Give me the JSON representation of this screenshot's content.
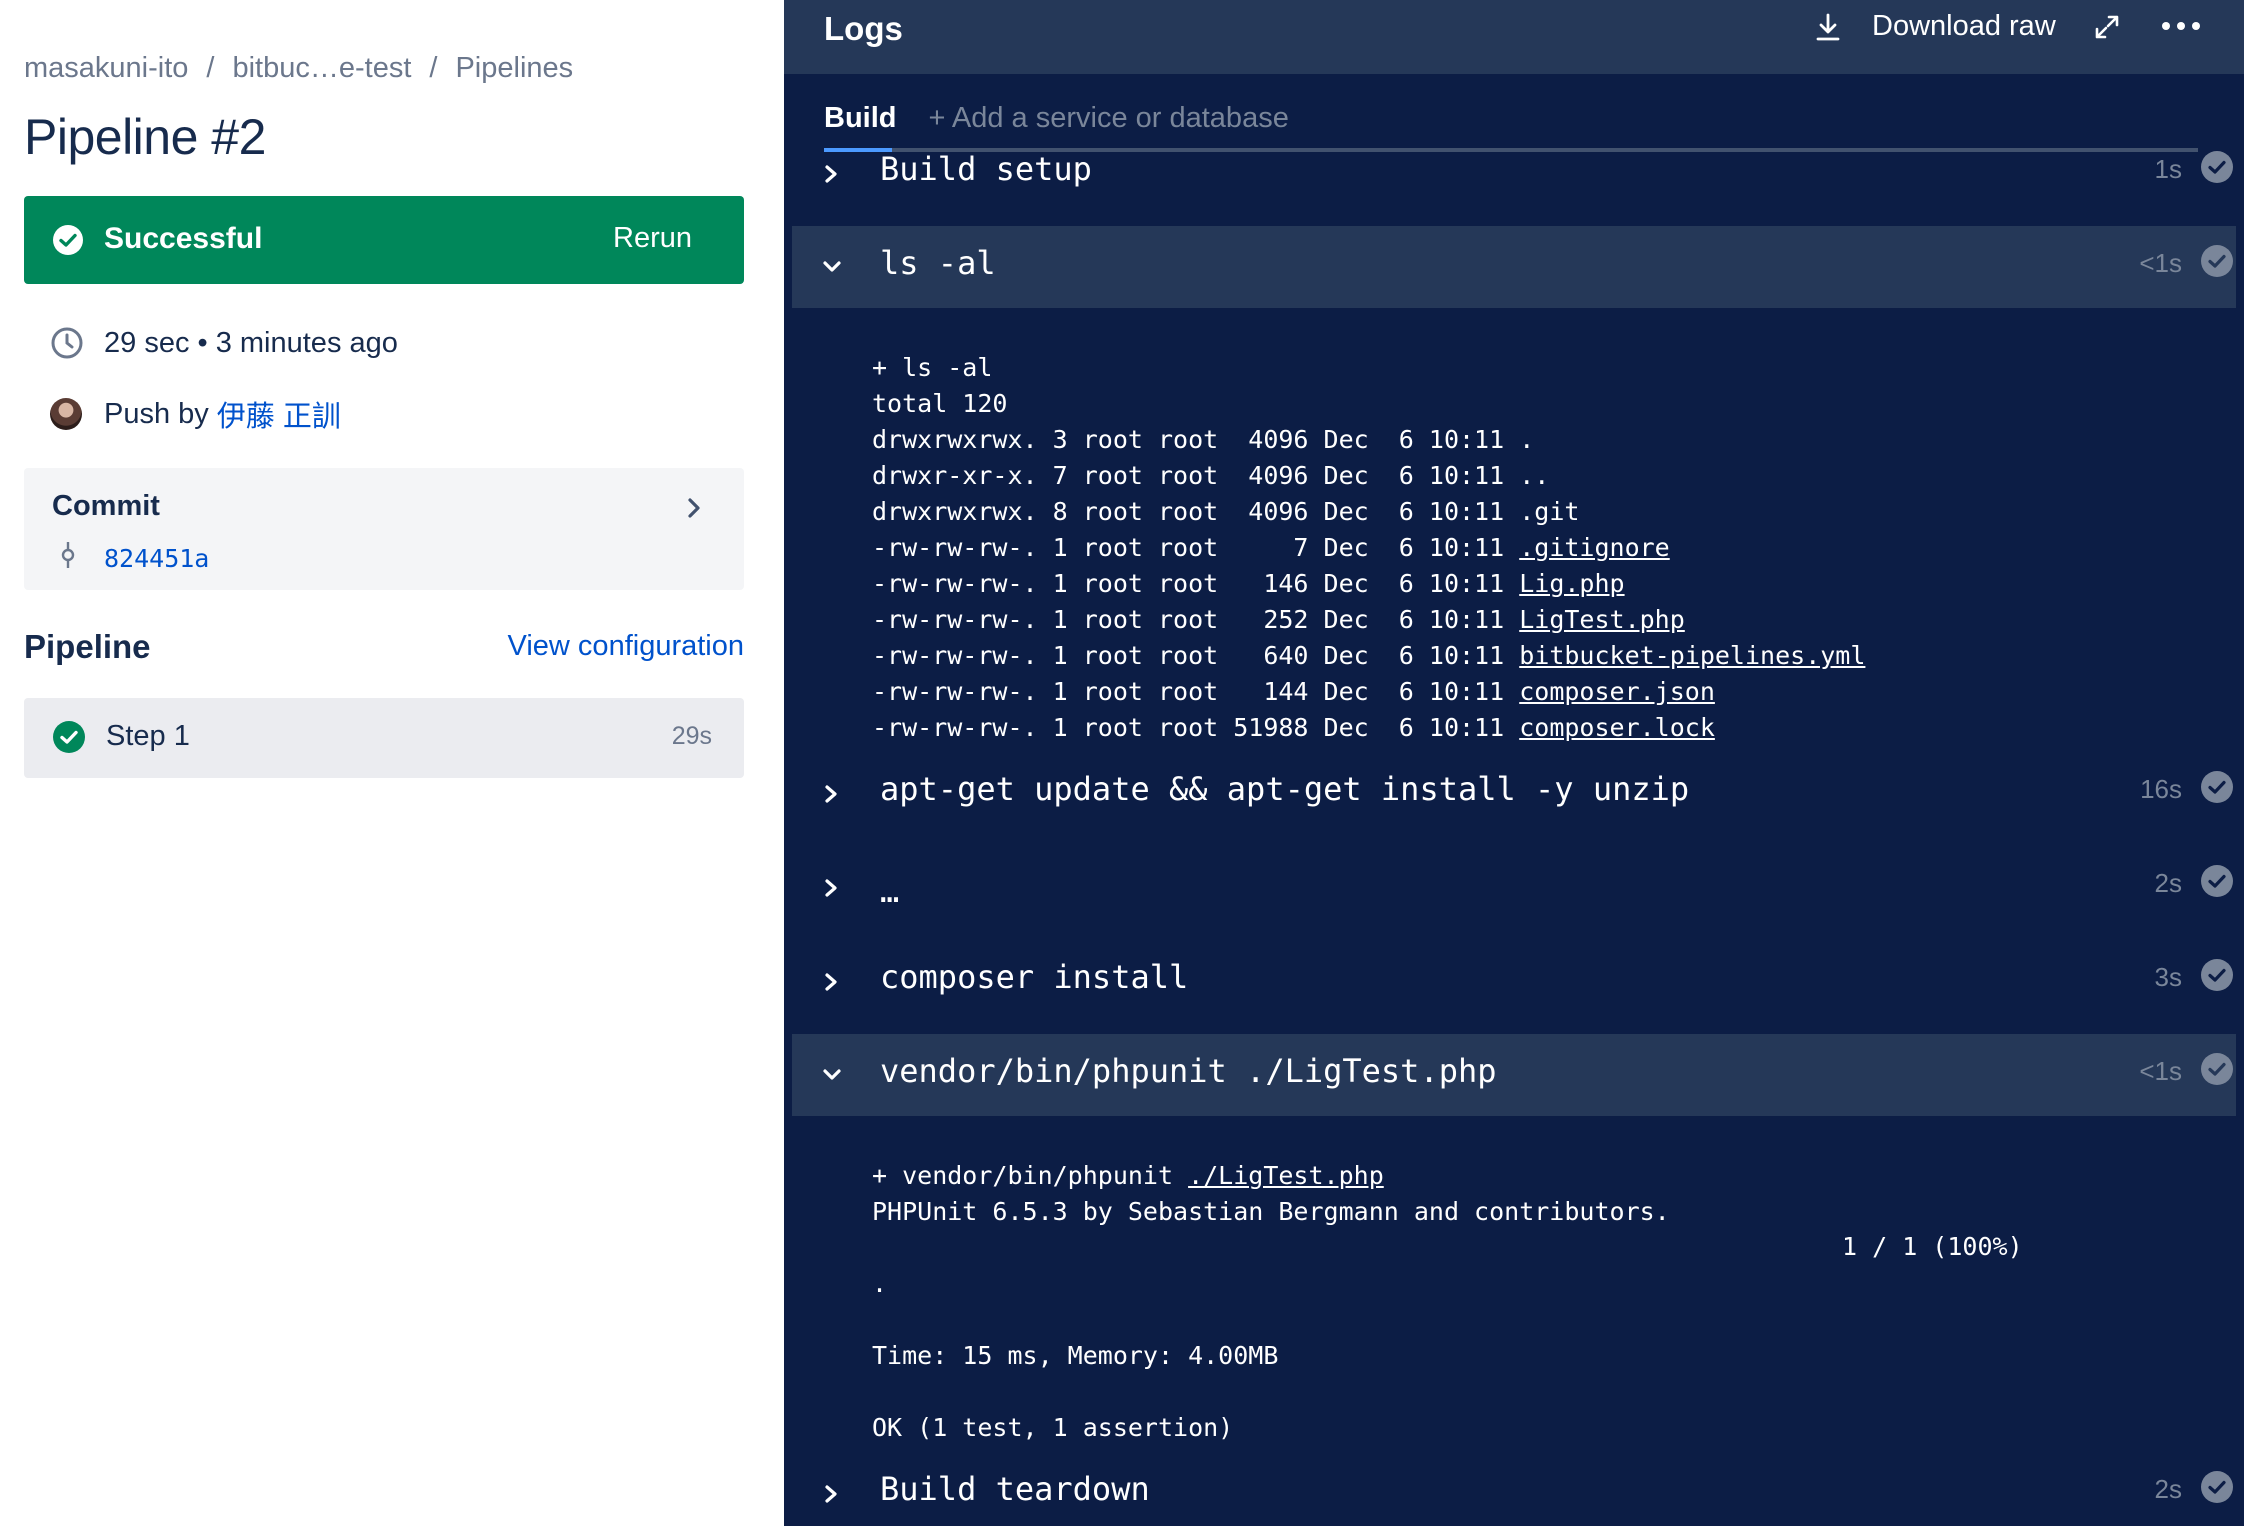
{
  "breadcrumb": {
    "items": [
      "masakuni-ito",
      "bitbuc…e-test",
      "Pipelines"
    ],
    "separator": "/"
  },
  "page_title": "Pipeline #2",
  "status": {
    "label": "Successful",
    "rerun_label": "Rerun",
    "color": "#00875a"
  },
  "meta": {
    "duration_text": "29 sec • 3 minutes ago",
    "push_prefix": "Push by",
    "author": "伊藤 正訓"
  },
  "commit": {
    "title": "Commit",
    "hash": "824451a"
  },
  "pipeline": {
    "title": "Pipeline",
    "view_config_label": "View configuration",
    "steps": [
      {
        "label": "Step 1",
        "duration": "29s"
      }
    ]
  },
  "logs": {
    "title": "Logs",
    "download_label": "Download raw",
    "tabs": {
      "build": "Build",
      "add": "+ Add a service or database"
    },
    "sections": [
      {
        "command": "Build setup",
        "duration": "1s",
        "expanded": false
      },
      {
        "command": "ls -al",
        "duration": "<1s",
        "expanded": true
      },
      {
        "command": "apt-get update && apt-get install -y unzip",
        "duration": "16s",
        "expanded": false
      },
      {
        "command": "…",
        "duration": "2s",
        "expanded": false
      },
      {
        "command": "composer install",
        "duration": "3s",
        "expanded": false
      },
      {
        "command": "vendor/bin/phpunit ./LigTest.php",
        "duration": "<1s",
        "expanded": true
      },
      {
        "command": "Build teardown",
        "duration": "2s",
        "expanded": false
      }
    ],
    "ls_output": {
      "cmd_line": "+ ls -al",
      "total": "total 120",
      "rows": [
        {
          "prefix": "drwxrwxrwx. 3 root root  4096 Dec  6 10:11 ",
          "name": ".",
          "link": false
        },
        {
          "prefix": "drwxr-xr-x. 7 root root  4096 Dec  6 10:11 ",
          "name": "..",
          "link": false
        },
        {
          "prefix": "drwxrwxrwx. 8 root root  4096 Dec  6 10:11 ",
          "name": ".git",
          "link": false
        },
        {
          "prefix": "-rw-rw-rw-. 1 root root     7 Dec  6 10:11 ",
          "name": ".gitignore",
          "link": true
        },
        {
          "prefix": "-rw-rw-rw-. 1 root root   146 Dec  6 10:11 ",
          "name": "Lig.php",
          "link": true
        },
        {
          "prefix": "-rw-rw-rw-. 1 root root   252 Dec  6 10:11 ",
          "name": "LigTest.php",
          "link": true
        },
        {
          "prefix": "-rw-rw-rw-. 1 root root   640 Dec  6 10:11 ",
          "name": "bitbucket-pipelines.yml",
          "link": true
        },
        {
          "prefix": "-rw-rw-rw-. 1 root root   144 Dec  6 10:11 ",
          "name": "composer.json",
          "link": true
        },
        {
          "prefix": "-rw-rw-rw-. 1 root root 51988 Dec  6 10:11 ",
          "name": "composer.lock",
          "link": true
        }
      ]
    },
    "phpunit_output": {
      "cmd_prefix": "+ vendor/bin/phpunit ",
      "cmd_file": "./LigTest.php",
      "version_line": "PHPUnit 6.5.3 by Sebastian Bergmann and contributors.",
      "progress_dot": ".",
      "progress_count": "1 / 1 (100%)",
      "time_line": "Time: 15 ms, Memory: 4.00MB",
      "result_line": "OK (1 test, 1 assertion)"
    }
  }
}
